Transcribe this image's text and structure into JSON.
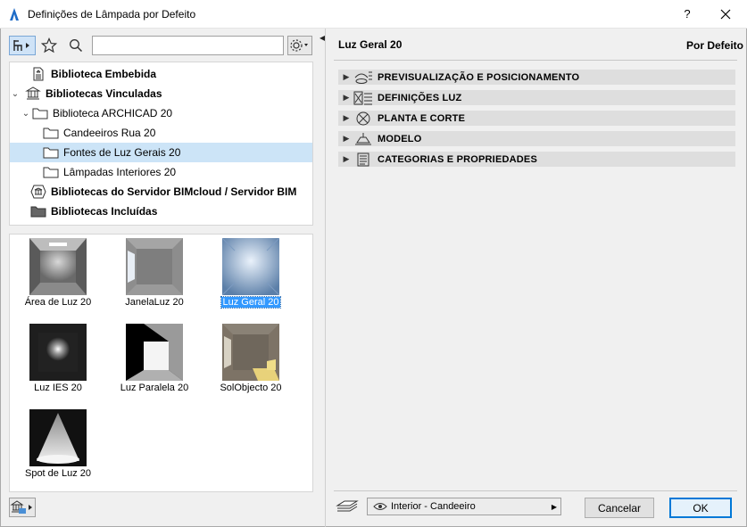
{
  "window": {
    "title": "Definições de Lâmpada por Defeito",
    "help_label": "?",
    "close_label": "✕"
  },
  "toolbar": {
    "search_placeholder": "",
    "search_value": ""
  },
  "tree": {
    "items": [
      {
        "label": "Biblioteca Embebida",
        "bold": true,
        "level": 0,
        "caret": "",
        "icon": "embedded-library-icon"
      },
      {
        "label": "Bibliotecas Vinculadas",
        "bold": true,
        "level": 0,
        "caret": "⌄",
        "icon": "linked-libraries-icon"
      },
      {
        "label": "Biblioteca ARCHICAD 20",
        "bold": false,
        "level": 1,
        "caret": "⌄",
        "icon": "folder-icon"
      },
      {
        "label": "Candeeiros Rua 20",
        "bold": false,
        "level": 2,
        "caret": "",
        "icon": "folder-icon"
      },
      {
        "label": "Fontes de Luz Gerais 20",
        "bold": false,
        "level": 2,
        "caret": "",
        "icon": "folder-icon",
        "selected": true
      },
      {
        "label": "Lâmpadas Interiores 20",
        "bold": false,
        "level": 2,
        "caret": "",
        "icon": "folder-icon"
      },
      {
        "label": "Bibliotecas do Servidor BIMcloud / Servidor BIM",
        "bold": true,
        "level": 0,
        "caret": "",
        "icon": "bim-server-icon"
      },
      {
        "label": "Bibliotecas Incluídas",
        "bold": true,
        "level": 0,
        "caret": "",
        "icon": "included-folder-icon"
      }
    ]
  },
  "thumbnails": [
    {
      "label": "Área de Luz 20",
      "selected": false,
      "icon": "area-light-thumb"
    },
    {
      "label": "JanelaLuz 20",
      "selected": false,
      "icon": "window-light-thumb"
    },
    {
      "label": "Luz Geral 20",
      "selected": true,
      "icon": "general-light-thumb"
    },
    {
      "label": "Luz IES 20",
      "selected": false,
      "icon": "ies-light-thumb"
    },
    {
      "label": "Luz Paralela 20",
      "selected": false,
      "icon": "parallel-light-thumb"
    },
    {
      "label": "SolObjecto 20",
      "selected": false,
      "icon": "sun-object-thumb"
    },
    {
      "label": "Spot de Luz 20",
      "selected": false,
      "icon": "spot-light-thumb"
    }
  ],
  "right": {
    "object_name": "Luz Geral 20",
    "default_label": "Por Defeito",
    "panels": [
      {
        "label": "PREVISUALIZAÇÃO E POSICIONAMENTO",
        "icon": "preview-icon"
      },
      {
        "label": "DEFINIÇÕES LUZ",
        "icon": "light-settings-icon"
      },
      {
        "label": "PLANTA E CORTE",
        "icon": "floor-plan-icon"
      },
      {
        "label": "MODELO",
        "icon": "model-lamp-icon"
      },
      {
        "label": "CATEGORIAS E PROPRIEDADES",
        "icon": "categories-icon"
      }
    ]
  },
  "footer": {
    "layer_value": "Interior - Candeeiro",
    "cancel_label": "Cancelar",
    "ok_label": "OK"
  }
}
